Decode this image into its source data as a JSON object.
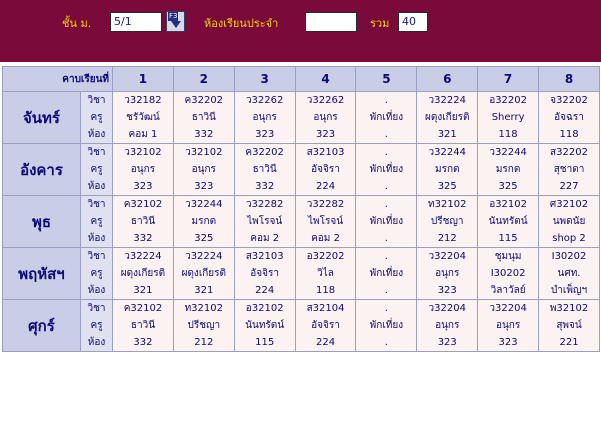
{
  "toolbar": {
    "grade_label": "ชั้น ม.",
    "grade_value": "5/1",
    "f3_label": "F3",
    "homeroom_label": "ห้องเรียนประจำ",
    "homeroom_value": "",
    "total_label": "รวม",
    "total_value": "40"
  },
  "table": {
    "corner_label": "คาบเรียนที่",
    "periods": [
      "1",
      "2",
      "3",
      "4",
      "5",
      "6",
      "7",
      "8"
    ],
    "row_labels": [
      "วิชา",
      "ครู",
      "ห้อง"
    ],
    "lunch_label": "พักเที่ยง",
    "days": [
      {
        "name": "จันทร์",
        "cells": [
          [
            "ว32182",
            "ชรัวัฒน์",
            "คอม 1"
          ],
          [
            "ค32202",
            "ธาวินี",
            "332"
          ],
          [
            "ว32262",
            "อนุกร",
            "323"
          ],
          [
            "ว32262",
            "อนุกร",
            "323"
          ],
          [
            ".",
            "พักเที่ยง",
            "."
          ],
          [
            "ว32224",
            "ผดุงเกียรติ",
            "321"
          ],
          [
            "อ32202",
            "Sherry",
            "118"
          ],
          [
            "จ32202",
            "อัจฉรา",
            "118"
          ]
        ]
      },
      {
        "name": "อังคาร",
        "cells": [
          [
            "ว32102",
            "อนุกร",
            "323"
          ],
          [
            "ว32102",
            "อนุกร",
            "323"
          ],
          [
            "ค32202",
            "ธาวินี",
            "332"
          ],
          [
            "ส32103",
            "อัจจิรา",
            "224"
          ],
          [
            ".",
            "พักเที่ยง",
            "."
          ],
          [
            "ว32244",
            "มรกต",
            "325"
          ],
          [
            "ว32244",
            "มรกต",
            "325"
          ],
          [
            "ส32202",
            "สุชาดา",
            "227"
          ]
        ]
      },
      {
        "name": "พุธ",
        "cells": [
          [
            "ค32102",
            "ธาวินี",
            "332"
          ],
          [
            "ว32244",
            "มรกต",
            "325"
          ],
          [
            "ว32282",
            "ไพโรจน์",
            "คอม 2"
          ],
          [
            "ว32282",
            "ไพโรจน์",
            "คอม 2"
          ],
          [
            ".",
            "พักเที่ยง",
            "."
          ],
          [
            "ท32102",
            "ปรีชญา",
            "212"
          ],
          [
            "อ32102",
            "นันทรัตน์",
            "115"
          ],
          [
            "ศ32102",
            "นพดนัย",
            "shop 2"
          ]
        ]
      },
      {
        "name": "พฤหัสฯ",
        "cells": [
          [
            "ว32224",
            "ผดุงเกียรติ",
            "321"
          ],
          [
            "ว32224",
            "ผดุงเกียรติ",
            "321"
          ],
          [
            "ส32103",
            "อัจจิรา",
            "224"
          ],
          [
            "อ32202",
            "วิไล",
            "118"
          ],
          [
            ".",
            "พักเที่ยง",
            "."
          ],
          [
            "ว32204",
            "อนุกร",
            "323"
          ],
          [
            "ชุมนุม",
            "I30202",
            "วิลาวัลย์"
          ],
          [
            "I30202",
            "นศท.",
            "บำเพ็ญฯ"
          ]
        ]
      },
      {
        "name": "ศุกร์",
        "cells": [
          [
            "ค32102",
            "ธาวินี",
            "332"
          ],
          [
            "ท32102",
            "ปรีชญา",
            "212"
          ],
          [
            "อ32102",
            "นันทรัตน์",
            "115"
          ],
          [
            "ส32104",
            "อัจจิรา",
            "224"
          ],
          [
            ".",
            "พักเที่ยง",
            "."
          ],
          [
            "ว32204",
            "อนุกร",
            "323"
          ],
          [
            "ว32204",
            "อนุกร",
            "323"
          ],
          [
            "พ32102",
            "สุพจน์",
            "221"
          ]
        ]
      }
    ]
  }
}
